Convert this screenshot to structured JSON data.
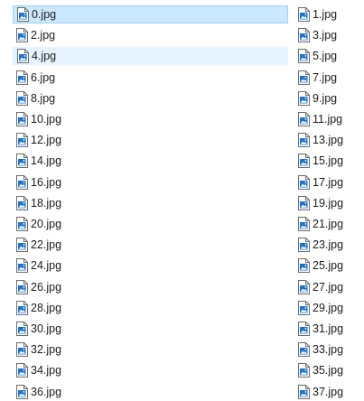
{
  "files": {
    "icon": "jpg-file-icon",
    "selected_index": 0,
    "hover_index": 2,
    "left_column": [
      "0.jpg",
      "2.jpg",
      "4.jpg",
      "6.jpg",
      "8.jpg",
      "10.jpg",
      "12.jpg",
      "14.jpg",
      "16.jpg",
      "18.jpg",
      "20.jpg",
      "22.jpg",
      "24.jpg",
      "26.jpg",
      "28.jpg",
      "30.jpg",
      "32.jpg",
      "34.jpg",
      "36.jpg"
    ],
    "right_column": [
      "1.jpg",
      "3.jpg",
      "5.jpg",
      "7.jpg",
      "9.jpg",
      "11.jpg",
      "13.jpg",
      "15.jpg",
      "17.jpg",
      "19.jpg",
      "21.jpg",
      "23.jpg",
      "25.jpg",
      "27.jpg",
      "29.jpg",
      "31.jpg",
      "33.jpg",
      "35.jpg",
      "37.jpg"
    ]
  },
  "colors": {
    "selected_bg": "#cce8ff",
    "selected_border": "#99d1ff",
    "hover_bg": "#e5f3ff",
    "icon_blue": "#1e73c8"
  }
}
